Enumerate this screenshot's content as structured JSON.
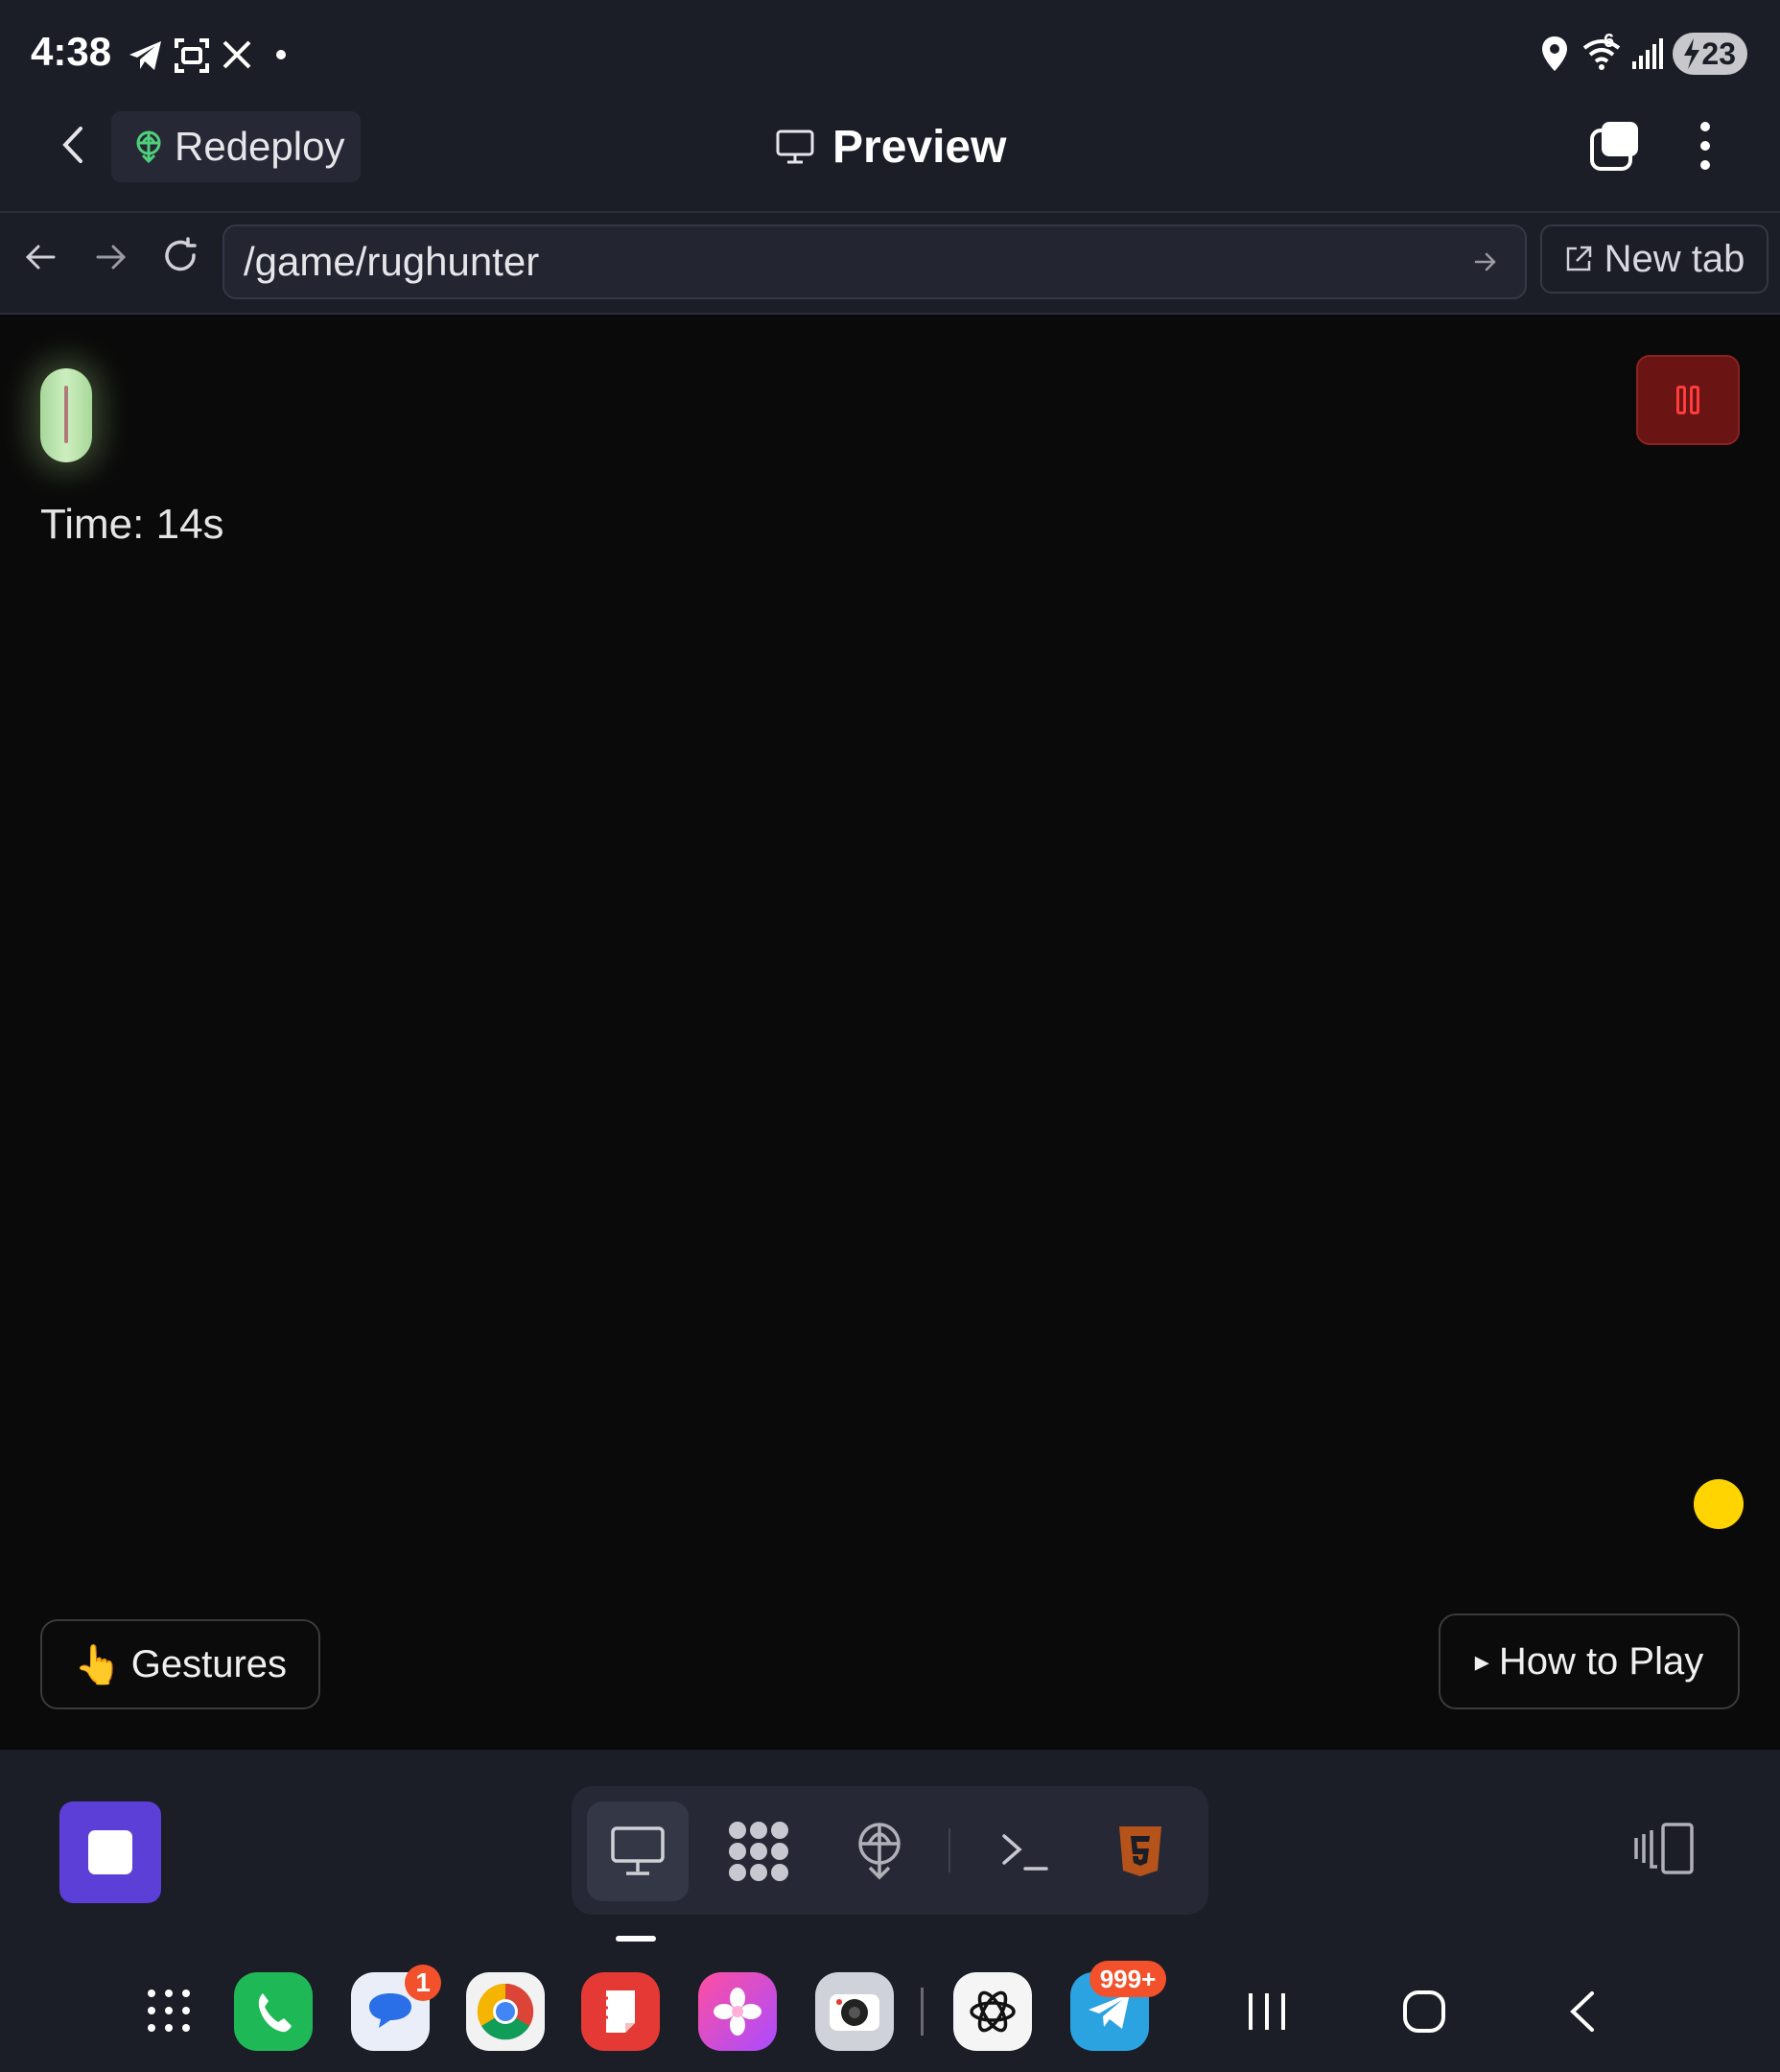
{
  "status_bar": {
    "time": "4:38",
    "wifi_label": "6",
    "battery": "23"
  },
  "header": {
    "redeploy_label": "Redeploy",
    "title": "Preview"
  },
  "url_bar": {
    "url": "/game/rughunter",
    "new_tab_label": "New tab"
  },
  "game": {
    "time_label": "Time: 14s",
    "gestures_emoji": "👆",
    "gestures_label": "Gestures",
    "how_to_play_arrow": "▸",
    "how_to_play_label": "How to Play"
  },
  "toolbar": {
    "tools": [
      "monitor-icon",
      "apps-grid-icon",
      "deploy-icon",
      "terminal-icon",
      "html5-icon"
    ]
  },
  "dock": {
    "messages_badge": "1",
    "telegram_badge": "999+"
  },
  "colors": {
    "accent_purple": "#5b3fd6",
    "pause_red": "#6a1414",
    "coin_yellow": "#ffd400",
    "player_green": "#b8e3a8"
  }
}
